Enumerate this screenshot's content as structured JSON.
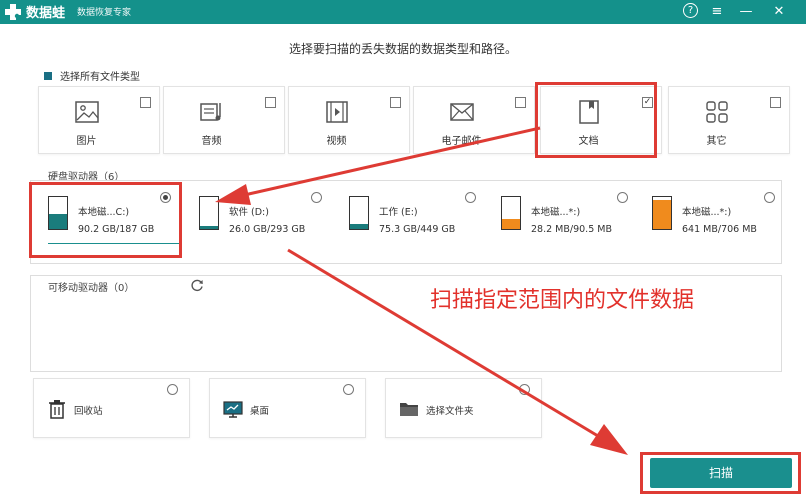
{
  "app": {
    "name": "数据蛙",
    "subtitle": "数据恢复专家"
  },
  "window_controls": {
    "help": "?",
    "menu": "≡",
    "minimize": "—",
    "close": "✕"
  },
  "instruction": "选择要扫描的丢失数据的数据类型和路径。",
  "select_all": {
    "label": "选择所有文件类型",
    "checked": true
  },
  "file_types": [
    {
      "label": "图片",
      "icon": "image-icon",
      "checked": false
    },
    {
      "label": "音频",
      "icon": "audio-icon",
      "checked": false
    },
    {
      "label": "视频",
      "icon": "video-icon",
      "checked": false
    },
    {
      "label": "电子邮件",
      "icon": "email-icon",
      "checked": false
    },
    {
      "label": "文档",
      "icon": "document-icon",
      "checked": true
    },
    {
      "label": "其它",
      "icon": "other-icon",
      "checked": false
    }
  ],
  "hard_drives": {
    "label": "硬盘驱动器（6）",
    "items": [
      {
        "name": "本地磁...C:)",
        "size": "90.2 GB/187 GB",
        "selected": true,
        "fill_ratio": 0.48,
        "color": "#1a7c7c"
      },
      {
        "name": "软件 (D:)",
        "size": "26.0 GB/293 GB",
        "selected": false,
        "fill_ratio": 0.09,
        "color": "#1a7c7c"
      },
      {
        "name": "工作 (E:)",
        "size": "75.3 GB/449 GB",
        "selected": false,
        "fill_ratio": 0.17,
        "color": "#1a7c7c"
      },
      {
        "name": "本地磁...*:)",
        "size": "28.2 MB/90.5 MB",
        "selected": false,
        "fill_ratio": 0.31,
        "color": "#f08b1d"
      },
      {
        "name": "本地磁...*:)",
        "size": "641 MB/706 MB",
        "selected": false,
        "fill_ratio": 0.91,
        "color": "#f08b1d"
      }
    ]
  },
  "removable": {
    "label": "可移动驱动器（0）"
  },
  "locations": [
    {
      "label": "回收站",
      "icon": "trash-icon"
    },
    {
      "label": "桌面",
      "icon": "desktop-icon"
    },
    {
      "label": "选择文件夹",
      "icon": "folder-icon"
    }
  ],
  "scan_button": "扫描",
  "annotation": "扫描指定范围内的文件数据",
  "colors": {
    "accent": "#14918b",
    "annotation_red": "#de3b34",
    "drive_teal": "#1a7c7c",
    "drive_orange": "#f08b1d"
  }
}
